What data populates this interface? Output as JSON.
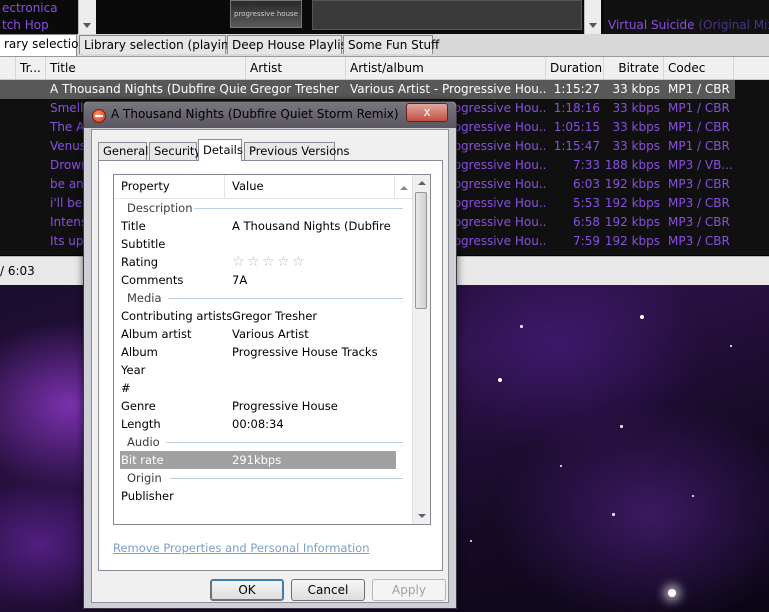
{
  "genre_list": [
    "ectronica",
    "tch Hop"
  ],
  "album_art_text": "progressive house",
  "now_playing_list": [
    {
      "artist": "",
      "suffix": ""
    },
    {
      "artist": "Virtual Suicide",
      "suffix": "(Original Mix)"
    }
  ],
  "tabs": [
    "rary selection",
    "Library selection (playing)",
    "Deep House Playlist",
    "Some Fun Stuff"
  ],
  "columns": [
    "Tr...",
    "Title",
    "Artist",
    "Artist/album",
    "Duration",
    "Bitrate",
    "Codec"
  ],
  "rows": [
    {
      "title": "A Thousand Nights (Dubfire Quiet ...",
      "artist": "Gregor Tresher",
      "album": "Various Artist - Progressive Hou...",
      "duration": "1:15:27",
      "bitrate": "33 kbps",
      "codec": "MP1 / CBR",
      "selected": true
    },
    {
      "title": "Smells",
      "artist": "",
      "album": "Various Artist - Progressive Hou...",
      "duration": "1:18:16",
      "bitrate": "33 kbps",
      "codec": "MP1 / CBR"
    },
    {
      "title": "The A",
      "artist": "",
      "album": "Various Artist - Progressive Hou...",
      "duration": "1:05:15",
      "bitrate": "33 kbps",
      "codec": "MP1 / CBR"
    },
    {
      "title": "Venus",
      "artist": "",
      "album": "Various Artist - Progressive Hou...",
      "duration": "1:15:47",
      "bitrate": "33 kbps",
      "codec": "MP1 / CBR"
    },
    {
      "title": "Drown",
      "artist": "",
      "album": "Various Artist - Progressive Hou...",
      "duration": "7:33",
      "bitrate": "188 kbps",
      "codec": "MP3 / VB..."
    },
    {
      "title": "be ang",
      "artist": "",
      "album": "Various Artist - Progressive Hou...",
      "duration": "6:03",
      "bitrate": "192 kbps",
      "codec": "MP3 / CBR"
    },
    {
      "title": "i'll be",
      "artist": "",
      "album": "Various Artist - Progressive Hou...",
      "duration": "5:53",
      "bitrate": "192 kbps",
      "codec": "MP3 / CBR"
    },
    {
      "title": "Intens",
      "artist": "",
      "album": "Various Artist - Progressive Hou...",
      "duration": "6:58",
      "bitrate": "192 kbps",
      "codec": "MP3 / CBR"
    },
    {
      "title": "Its up",
      "artist": "",
      "album": "Various Artist - Progressive Hou...",
      "duration": "7:59",
      "bitrate": "192 kbps",
      "codec": "MP3 / CBR"
    }
  ],
  "status_text": "/ 6:03",
  "dialog": {
    "title": "A Thousand Nights (Dubfire Quiet Storm Remix) Prop...",
    "close_label": "x",
    "tabs": [
      "General",
      "Security",
      "Details",
      "Previous Versions"
    ],
    "list_header": {
      "property": "Property",
      "value": "Value"
    },
    "properties": [
      {
        "group": "Description"
      },
      {
        "key": "Title",
        "value": "A Thousand Nights (Dubfire Qu..."
      },
      {
        "key": "Subtitle",
        "value": ""
      },
      {
        "key": "Rating",
        "stars": 5
      },
      {
        "key": "Comments",
        "value": "7A"
      },
      {
        "group": "Media"
      },
      {
        "key": "Contributing artists",
        "value": "Gregor Tresher"
      },
      {
        "key": "Album artist",
        "value": "Various Artist"
      },
      {
        "key": "Album",
        "value": "Progressive House Tracks"
      },
      {
        "key": "Year",
        "value": ""
      },
      {
        "key": "#",
        "value": ""
      },
      {
        "key": "Genre",
        "value": "Progressive House"
      },
      {
        "key": "Length",
        "value": "00:08:34"
      },
      {
        "group": "Audio"
      },
      {
        "key": "Bit rate",
        "value": "291kbps",
        "selected": true
      },
      {
        "group": "Origin"
      },
      {
        "key": "Publisher",
        "value": ""
      }
    ],
    "remove_link": "Remove Properties and Personal Information",
    "buttons": {
      "ok": "OK",
      "cancel": "Cancel",
      "apply": "Apply"
    }
  }
}
